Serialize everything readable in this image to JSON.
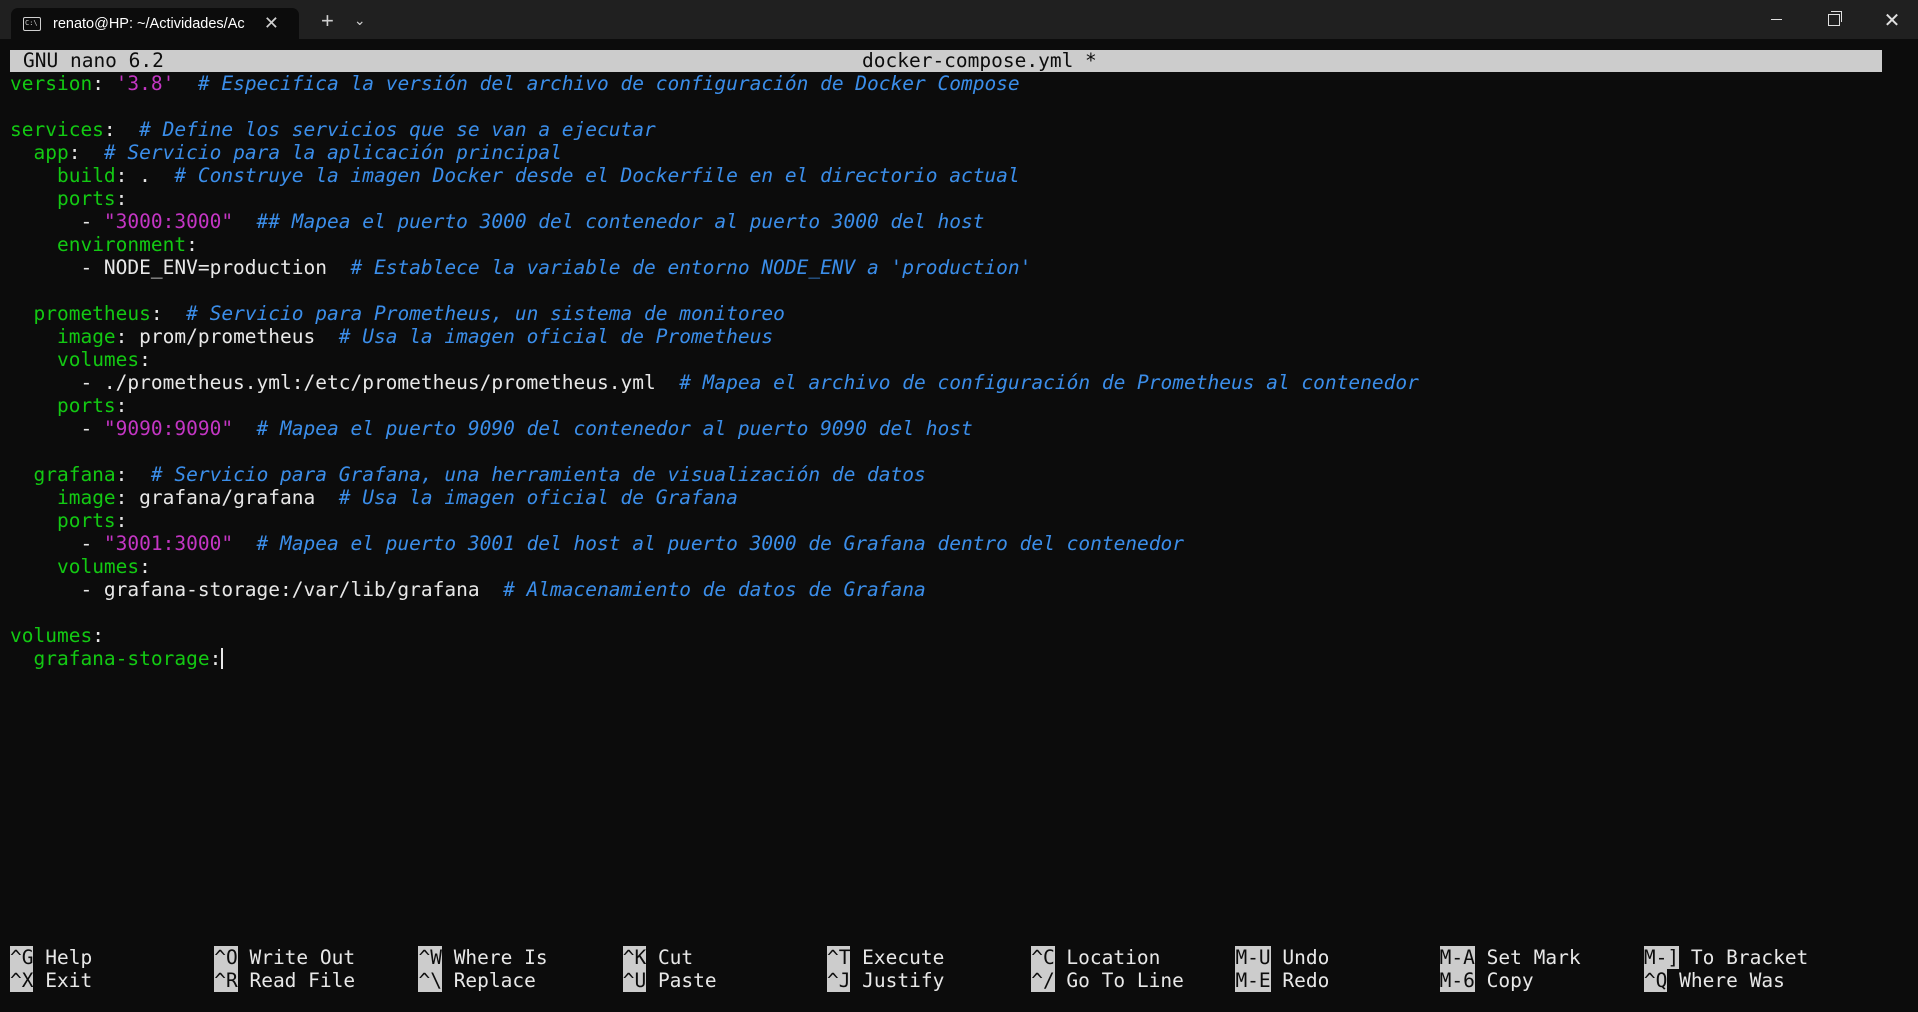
{
  "window": {
    "tab_title": "renato@HP: ~/Actividades/Ac",
    "tab_icon": "terminal-icon",
    "new_tab_label": "+",
    "dropdown_label": "⌄",
    "minimize_label": "",
    "close_label": "✕"
  },
  "nano": {
    "version": "GNU nano 6.2",
    "filename": "docker-compose.yml *"
  },
  "file_lines": [
    [
      {
        "t": "k",
        "v": "version"
      },
      {
        "t": "w",
        "v": ": "
      },
      {
        "t": "s",
        "v": "'3.8'"
      },
      {
        "t": "w",
        "v": "  "
      },
      {
        "t": "c",
        "v": "# Especifica la versión del archivo de configuración de Docker Compose"
      }
    ],
    [],
    [
      {
        "t": "k",
        "v": "services"
      },
      {
        "t": "w",
        "v": ":  "
      },
      {
        "t": "c",
        "v": "# Define los servicios que se van a ejecutar"
      }
    ],
    [
      {
        "t": "w",
        "v": "  "
      },
      {
        "t": "k",
        "v": "app"
      },
      {
        "t": "w",
        "v": ":  "
      },
      {
        "t": "c",
        "v": "# Servicio para la aplicación principal"
      }
    ],
    [
      {
        "t": "w",
        "v": "    "
      },
      {
        "t": "k",
        "v": "build"
      },
      {
        "t": "w",
        "v": ": .  "
      },
      {
        "t": "c",
        "v": "# Construye la imagen Docker desde el Dockerfile en el directorio actual"
      }
    ],
    [
      {
        "t": "w",
        "v": "    "
      },
      {
        "t": "k",
        "v": "ports"
      },
      {
        "t": "w",
        "v": ":"
      }
    ],
    [
      {
        "t": "w",
        "v": "      - "
      },
      {
        "t": "s",
        "v": "\"3000:3000\""
      },
      {
        "t": "w",
        "v": "  "
      },
      {
        "t": "c",
        "v": "## Mapea el puerto 3000 del contenedor al puerto 3000 del host"
      }
    ],
    [
      {
        "t": "w",
        "v": "    "
      },
      {
        "t": "k",
        "v": "environment"
      },
      {
        "t": "w",
        "v": ":"
      }
    ],
    [
      {
        "t": "w",
        "v": "      - NODE_ENV=production  "
      },
      {
        "t": "c",
        "v": "# Establece la variable de entorno NODE_ENV a 'production'"
      }
    ],
    [],
    [
      {
        "t": "w",
        "v": "  "
      },
      {
        "t": "k",
        "v": "prometheus"
      },
      {
        "t": "w",
        "v": ":  "
      },
      {
        "t": "c",
        "v": "# Servicio para Prometheus, un sistema de monitoreo"
      }
    ],
    [
      {
        "t": "w",
        "v": "    "
      },
      {
        "t": "k",
        "v": "image"
      },
      {
        "t": "w",
        "v": ": prom/prometheus  "
      },
      {
        "t": "c",
        "v": "# Usa la imagen oficial de Prometheus"
      }
    ],
    [
      {
        "t": "w",
        "v": "    "
      },
      {
        "t": "k",
        "v": "volumes"
      },
      {
        "t": "w",
        "v": ":"
      }
    ],
    [
      {
        "t": "w",
        "v": "      - ./prometheus.yml:/etc/prometheus/prometheus.yml  "
      },
      {
        "t": "c",
        "v": "# Mapea el archivo de configuración de Prometheus al contenedor"
      }
    ],
    [
      {
        "t": "w",
        "v": "    "
      },
      {
        "t": "k",
        "v": "ports"
      },
      {
        "t": "w",
        "v": ":"
      }
    ],
    [
      {
        "t": "w",
        "v": "      - "
      },
      {
        "t": "s",
        "v": "\"9090:9090\""
      },
      {
        "t": "w",
        "v": "  "
      },
      {
        "t": "c",
        "v": "# Mapea el puerto 9090 del contenedor al puerto 9090 del host"
      }
    ],
    [],
    [
      {
        "t": "w",
        "v": "  "
      },
      {
        "t": "k",
        "v": "grafana"
      },
      {
        "t": "w",
        "v": ":  "
      },
      {
        "t": "c",
        "v": "# Servicio para Grafana, una herramienta de visualización de datos"
      }
    ],
    [
      {
        "t": "w",
        "v": "    "
      },
      {
        "t": "k",
        "v": "image"
      },
      {
        "t": "w",
        "v": ": grafana/grafana  "
      },
      {
        "t": "c",
        "v": "# Usa la imagen oficial de Grafana"
      }
    ],
    [
      {
        "t": "w",
        "v": "    "
      },
      {
        "t": "k",
        "v": "ports"
      },
      {
        "t": "w",
        "v": ":"
      }
    ],
    [
      {
        "t": "w",
        "v": "      - "
      },
      {
        "t": "s",
        "v": "\"3001:3000\""
      },
      {
        "t": "w",
        "v": "  "
      },
      {
        "t": "c",
        "v": "# Mapea el puerto 3001 del host al puerto 3000 de Grafana dentro del contenedor"
      }
    ],
    [
      {
        "t": "w",
        "v": "    "
      },
      {
        "t": "k",
        "v": "volumes"
      },
      {
        "t": "w",
        "v": ":"
      }
    ],
    [
      {
        "t": "w",
        "v": "      - grafana-storage:/var/lib/grafana  "
      },
      {
        "t": "c",
        "v": "# Almacenamiento de datos de Grafana"
      }
    ],
    [],
    [
      {
        "t": "k",
        "v": "volumes"
      },
      {
        "t": "w",
        "v": ":"
      }
    ],
    [
      {
        "t": "w",
        "v": "  "
      },
      {
        "t": "k",
        "v": "grafana-storage"
      },
      {
        "t": "w",
        "v": ":"
      },
      {
        "t": "cursor",
        "v": ""
      }
    ]
  ],
  "shortcuts_row1": [
    {
      "key": "^G",
      "label": "Help"
    },
    {
      "key": "^O",
      "label": "Write Out"
    },
    {
      "key": "^W",
      "label": "Where Is"
    },
    {
      "key": "^K",
      "label": "Cut"
    },
    {
      "key": "^T",
      "label": "Execute"
    },
    {
      "key": "^C",
      "label": "Location"
    },
    {
      "key": "M-U",
      "label": "Undo"
    },
    {
      "key": "M-A",
      "label": "Set Mark"
    },
    {
      "key": "M-]",
      "label": "To Bracket"
    }
  ],
  "shortcuts_row2": [
    {
      "key": "^X",
      "label": "Exit"
    },
    {
      "key": "^R",
      "label": "Read File"
    },
    {
      "key": "^\\",
      "label": "Replace"
    },
    {
      "key": "^U",
      "label": "Paste"
    },
    {
      "key": "^J",
      "label": "Justify"
    },
    {
      "key": "^/",
      "label": "Go To Line"
    },
    {
      "key": "M-E",
      "label": "Redo"
    },
    {
      "key": "M-6",
      "label": "Copy"
    },
    {
      "key": "^Q",
      "label": "Where Was"
    }
  ],
  "colors": {
    "background": "#0c0c0c",
    "keyword": "#13c913",
    "comment": "#3b8eea",
    "string": "#c436c4",
    "text": "#e8e8e8",
    "bar": "#cccccc"
  }
}
